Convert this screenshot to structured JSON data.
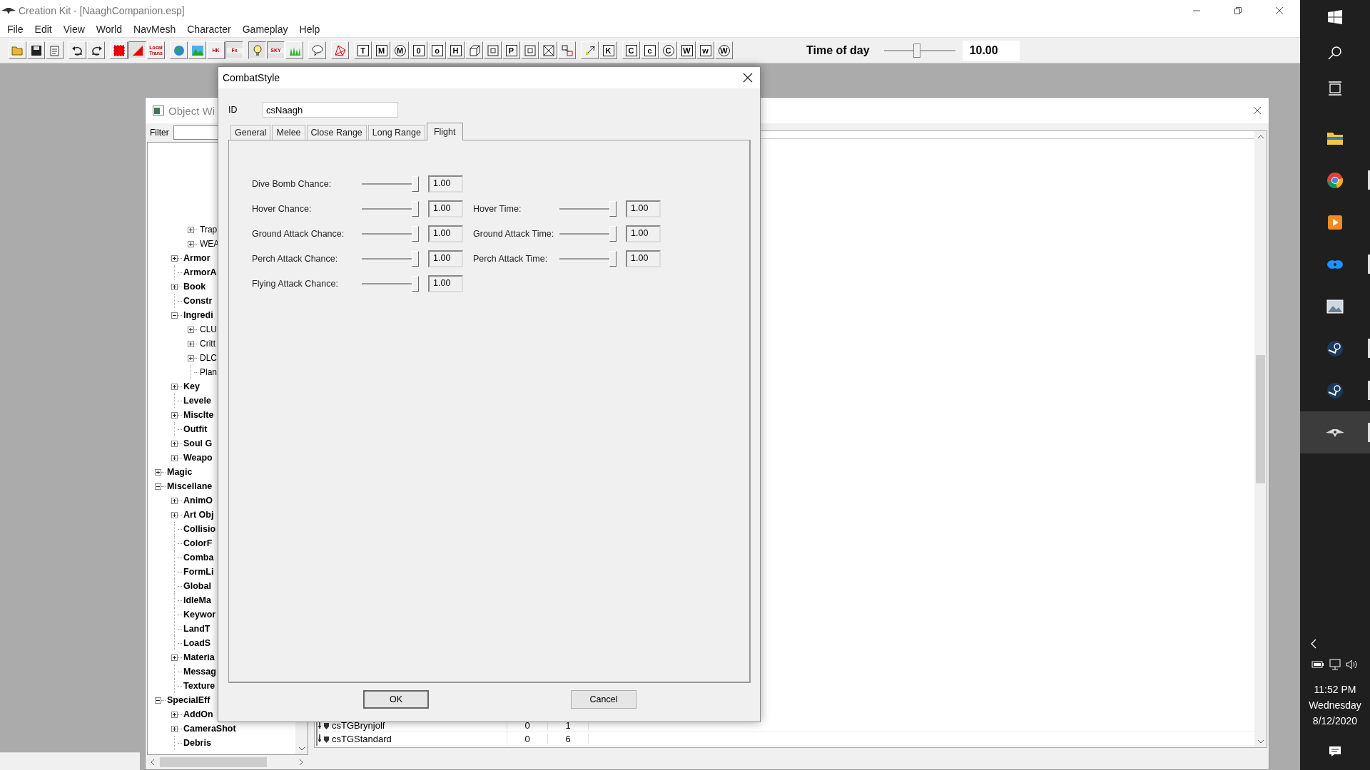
{
  "window": {
    "title": "Creation Kit - [NaaghCompanion.esp]"
  },
  "menu": [
    "File",
    "Edit",
    "View",
    "World",
    "NavMesh",
    "Character",
    "Gameplay",
    "Help"
  ],
  "toolbar": {
    "groups": [
      [
        {
          "kind": "folder",
          "on": false
        },
        {
          "kind": "floppy",
          "on": false
        },
        {
          "kind": "prefs",
          "on": false
        }
      ],
      [
        {
          "kind": "undo",
          "on": false
        },
        {
          "kind": "redo",
          "on": false
        }
      ],
      [
        {
          "kind": "render",
          "on": false
        },
        {
          "kind": "triangle",
          "on": true
        },
        {
          "kind": "text",
          "glyph": "Local Trans",
          "on": false
        }
      ],
      [
        {
          "kind": "globe",
          "on": false
        },
        {
          "kind": "landscape",
          "on": false
        },
        {
          "kind": "text",
          "glyph": "HK",
          "on": false
        },
        {
          "kind": "text",
          "glyph": "Fx",
          "on": true
        }
      ],
      [
        {
          "kind": "bulb",
          "on": true
        },
        {
          "kind": "text",
          "glyph": "SKY",
          "on": true
        },
        {
          "kind": "grass",
          "on": false
        }
      ],
      [
        {
          "kind": "bubble",
          "on": false
        }
      ],
      [
        {
          "kind": "navmesh",
          "on": false
        }
      ],
      [
        {
          "kind": "box",
          "glyph": "T",
          "on": false
        },
        {
          "kind": "box",
          "glyph": "M",
          "on": false
        },
        {
          "kind": "circle",
          "glyph": "M",
          "on": false
        },
        {
          "kind": "box",
          "glyph": "0",
          "on": false
        },
        {
          "kind": "box",
          "glyph": "o",
          "on": false
        },
        {
          "kind": "box",
          "glyph": "H",
          "on": false
        },
        {
          "kind": "cube",
          "on": false
        },
        {
          "kind": "square",
          "on": false
        },
        {
          "kind": "box",
          "glyph": "P",
          "on": false
        },
        {
          "kind": "square",
          "on": false
        },
        {
          "kind": "xbox",
          "on": false
        },
        {
          "kind": "link",
          "on": false
        }
      ],
      [
        {
          "kind": "arrow",
          "on": false
        },
        {
          "kind": "box",
          "glyph": "K",
          "on": false
        }
      ],
      [
        {
          "kind": "box",
          "glyph": "C",
          "on": false
        },
        {
          "kind": "box",
          "glyph": "c",
          "on": false
        },
        {
          "kind": "circle",
          "glyph": "C",
          "on": false
        },
        {
          "kind": "box",
          "glyph": "W",
          "on": false
        },
        {
          "kind": "box",
          "glyph": "w",
          "on": false
        },
        {
          "kind": "circle",
          "glyph": "W",
          "on": false
        }
      ]
    ],
    "time_of_day": {
      "label": "Time of day",
      "level": 0.46,
      "value": "10.00"
    }
  },
  "object_window": {
    "title": "Object Wi",
    "filter": {
      "label": "Filter"
    },
    "tree": [
      {
        "children": [
          {
            "children": [
              {
                "label": "Trap",
                "expanded": false
              },
              {
                "label": "WEA",
                "expanded": false
              }
            ]
          },
          {
            "label": "Armor",
            "expanded": false
          },
          {
            "label": "ArmorA"
          },
          {
            "label": "Book",
            "expanded": false
          },
          {
            "label": "Constr"
          },
          {
            "label": "Ingredi",
            "expanded": true,
            "children": [
              {
                "label": "CLU",
                "expanded": false
              },
              {
                "label": "Critt",
                "expanded": false
              },
              {
                "label": "DLC",
                "expanded": false
              },
              {
                "label": "Plan"
              }
            ]
          },
          {
            "label": "Key",
            "expanded": false
          },
          {
            "label": "Levele"
          },
          {
            "label": "MiscIte",
            "expanded": false
          },
          {
            "label": "Outfit"
          },
          {
            "label": "Soul G",
            "expanded": false
          },
          {
            "label": "Weapo",
            "expanded": false
          }
        ]
      },
      {
        "label": "Magic",
        "expanded": false
      },
      {
        "label": "Miscellane",
        "expanded": true,
        "children": [
          {
            "label": "AnimO",
            "expanded": false
          },
          {
            "label": "Art Obj",
            "expanded": false
          },
          {
            "label": "Collisio"
          },
          {
            "label": "ColorF"
          },
          {
            "label": "Comba"
          },
          {
            "label": "FormLi"
          },
          {
            "label": "Global"
          },
          {
            "label": "IdleMa"
          },
          {
            "label": "Keywor"
          },
          {
            "label": "LandT"
          },
          {
            "label": "LoadS"
          },
          {
            "label": "Materia",
            "expanded": false
          },
          {
            "label": "Messag"
          },
          {
            "label": "Texture"
          }
        ]
      },
      {
        "label": "SpecialEff",
        "expanded": true,
        "children": [
          {
            "label": "AddOn",
            "expanded": false
          },
          {
            "label": "CameraShot",
            "expanded": false
          },
          {
            "label": "Debris"
          }
        ]
      }
    ],
    "list": {
      "rows": [
        {
          "name": "csTGBrynjolf",
          "column_2": "0",
          "column_3": "1"
        },
        {
          "name": "csTGStandard",
          "column_2": "0",
          "column_3": "6"
        }
      ]
    }
  },
  "dialog": {
    "title": "CombatStyle",
    "id": {
      "label": "ID",
      "value": "csNaagh"
    },
    "tabs": [
      {
        "label": "General",
        "selected": false
      },
      {
        "label": "Melee",
        "selected": false
      },
      {
        "label": "Close Range",
        "selected": false
      },
      {
        "label": "Long Range",
        "selected": false
      },
      {
        "label": "Flight",
        "selected": true
      }
    ],
    "rows": [
      [
        {
          "label": "Dive Bomb Chance:",
          "level": 1,
          "reading": "1.00"
        }
      ],
      [
        {
          "label": "Hover Chance:",
          "level": 1,
          "reading": "1.00"
        },
        {
          "label": "Hover Time:",
          "level": 1,
          "reading": "1.00"
        }
      ],
      [
        {
          "label": "Ground Attack Chance:",
          "level": 1,
          "reading": "1.00"
        },
        {
          "label": "Ground Attack Time:",
          "level": 1,
          "reading": "1.00"
        }
      ],
      [
        {
          "label": "Perch Attack Chance:",
          "level": 1,
          "reading": "1.00"
        },
        {
          "label": "Perch Attack Time:",
          "level": 1,
          "reading": "1.00"
        }
      ],
      [
        {
          "label": "Flying Attack Chance:",
          "level": 1,
          "reading": "1.00"
        }
      ]
    ],
    "buttons": [
      {
        "label": "OK",
        "default": true
      },
      {
        "label": "Cancel",
        "default": false
      }
    ]
  },
  "taskbar": {
    "apps": [
      {
        "kind": "explorer",
        "running": false,
        "selected": false
      },
      {
        "kind": "browser",
        "running": true,
        "selected": false
      },
      {
        "kind": "player",
        "running": false,
        "selected": false
      },
      {
        "kind": "oval",
        "running": true,
        "selected": false
      },
      {
        "kind": "photos",
        "running": false,
        "selected": false
      },
      {
        "kind": "steam",
        "running": true,
        "selected": false
      },
      {
        "kind": "steam",
        "running": true,
        "selected": false
      },
      {
        "kind": "ck",
        "running": true,
        "selected": true
      }
    ],
    "clock": {
      "time": "11:52 PM",
      "day": "Wednesday",
      "date": "8/12/2020"
    }
  }
}
